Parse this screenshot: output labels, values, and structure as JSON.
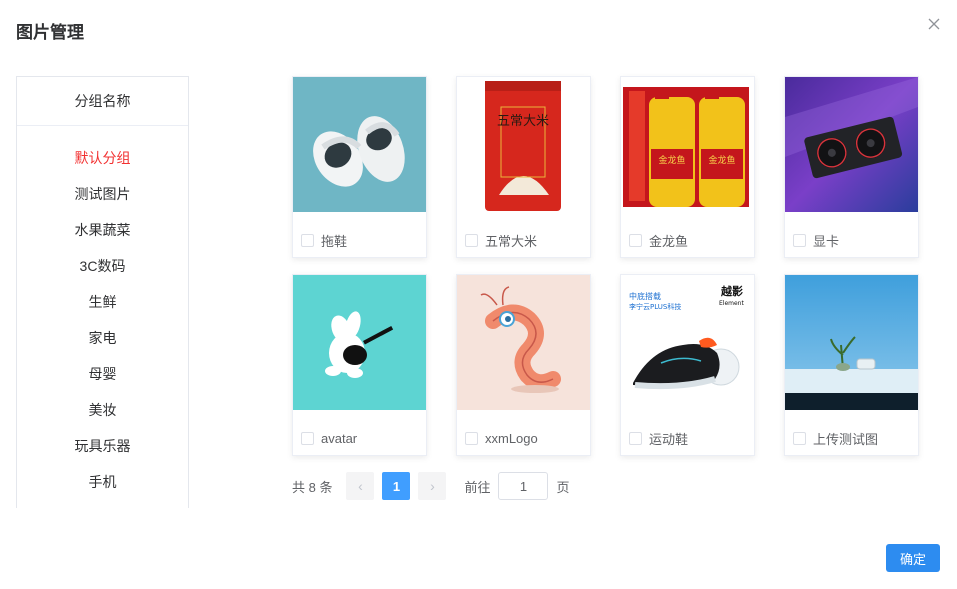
{
  "dialog": {
    "title": "图片管理",
    "confirm_label": "确定"
  },
  "groups": {
    "header": "分组名称",
    "items": [
      {
        "label": "默认分组",
        "active": true
      },
      {
        "label": "测试图片"
      },
      {
        "label": "水果蔬菜"
      },
      {
        "label": "3C数码"
      },
      {
        "label": "生鲜"
      },
      {
        "label": "家电"
      },
      {
        "label": "母婴"
      },
      {
        "label": "美妆"
      },
      {
        "label": "玩具乐器"
      },
      {
        "label": "手机"
      }
    ]
  },
  "images": [
    {
      "name": "拖鞋",
      "checked": false
    },
    {
      "name": "五常大米",
      "checked": false
    },
    {
      "name": "金龙鱼",
      "checked": false
    },
    {
      "name": "显卡",
      "checked": false
    },
    {
      "name": "avatar",
      "checked": false
    },
    {
      "name": "xxmLogo",
      "checked": false
    },
    {
      "name": "运动鞋",
      "checked": false
    },
    {
      "name": "上传测试图",
      "checked": false
    }
  ],
  "thumb_text": {
    "rice": "五常大米",
    "oil": "金龙鱼",
    "shoe_brand": "越影",
    "shoe_brand_en": "Element",
    "shoe_promo": "中底搭载",
    "shoe_tech": "李宁云PLUS科技"
  },
  "pagination": {
    "total": "共 8 条",
    "prev": "‹",
    "next": "›",
    "current_page": "1",
    "goto_label": "前往",
    "goto_value": "1",
    "page_unit": "页"
  },
  "colors": {
    "active_group": "#f23030",
    "pager_active": "#409eff",
    "confirm": "#2d8cf0"
  },
  "icons": {
    "close": "close-icon"
  }
}
